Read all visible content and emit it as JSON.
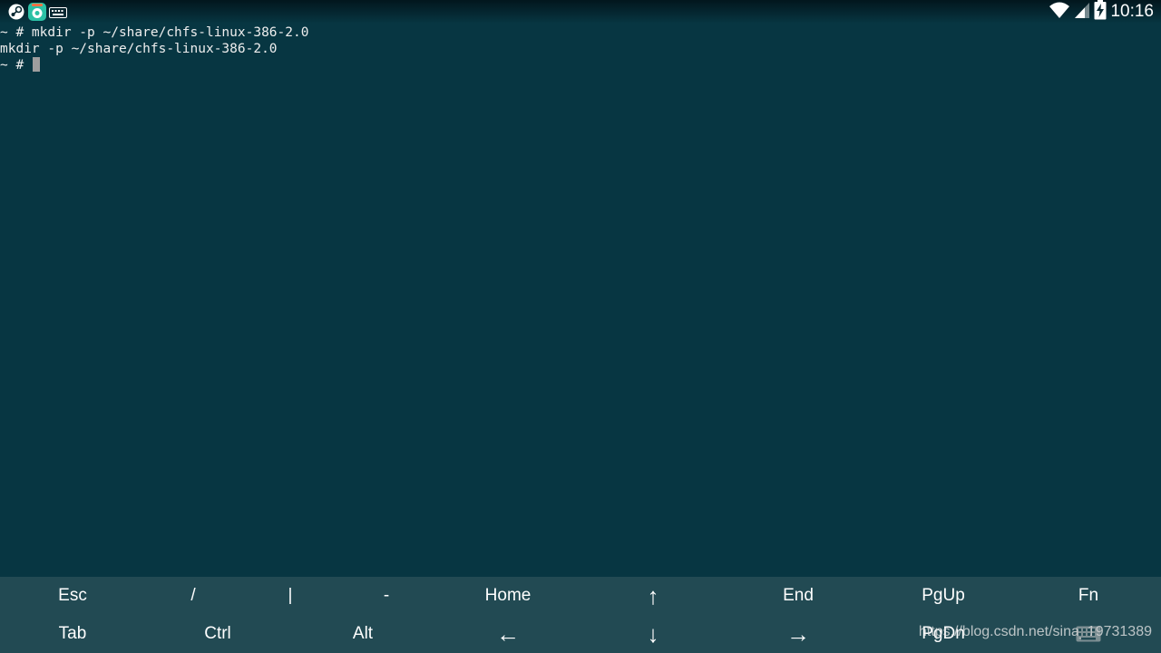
{
  "status_bar": {
    "time": "10:16",
    "left_icons": [
      "steam-icon",
      "app-store-icon",
      "keyboard-icon"
    ],
    "right_icons": [
      "wifi-icon",
      "signal-icon",
      "battery-charging-icon"
    ]
  },
  "terminal": {
    "lines": [
      "~ # mkdir -p ~/share/chfs-linux-386-2.0",
      "mkdir -p ~/share/chfs-linux-386-2.0",
      "~ # "
    ]
  },
  "extra_keys": {
    "row1": [
      "Esc",
      "/",
      "|",
      "-",
      "Home",
      "↑",
      "End",
      "PgUp",
      "Fn"
    ],
    "row2": [
      "Tab",
      "Ctrl",
      "Alt",
      "←",
      "↓",
      "→",
      "PgDn"
    ]
  },
  "watermark": "https://blog.csdn.net/sina_19731389",
  "colors": {
    "terminal_bg": "#073642",
    "extra_keys_bg": "#224a53",
    "text": "#eeeeee",
    "cursor": "#9e9e9e"
  }
}
